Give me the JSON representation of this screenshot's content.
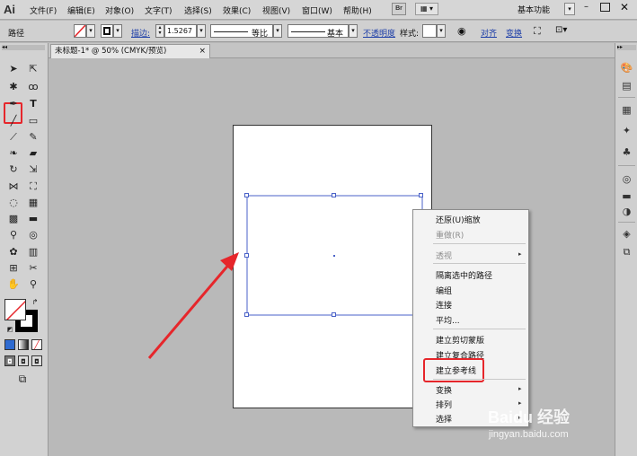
{
  "menubar": {
    "logo": "Ai",
    "items": [
      "文件(F)",
      "编辑(E)",
      "对象(O)",
      "文字(T)",
      "选择(S)",
      "效果(C)",
      "视图(V)",
      "窗口(W)",
      "帮助(H)"
    ],
    "bridge_label": "Br",
    "workspace_label": "基本功能",
    "minimize_glyph": "–",
    "close_glyph": "✕"
  },
  "controlbar": {
    "path_label": "路径",
    "stroke_label": "描边:",
    "stroke_weight": "1.5267",
    "stroke_profile": "等比",
    "brush_label": "基本",
    "opacity_label": "不透明度",
    "style_label": "样式:",
    "align_label": "对齐",
    "transform_label": "变换"
  },
  "document": {
    "tab_title": "未标题-1* @ 50% (CMYK/预览)",
    "tab_close": "×"
  },
  "context_menu": {
    "items": [
      {
        "label": "还原(U)缩放",
        "disabled": false
      },
      {
        "label": "重做(R)",
        "disabled": true
      },
      {
        "label": "透视",
        "disabled": true,
        "submenu": true
      },
      {
        "label": "隔离选中的路径",
        "disabled": false
      },
      {
        "label": "编组",
        "disabled": false
      },
      {
        "label": "连接",
        "disabled": false
      },
      {
        "label": "平均...",
        "disabled": false
      },
      {
        "label": "建立剪切蒙版",
        "disabled": false
      },
      {
        "label": "建立复合路径",
        "disabled": false
      },
      {
        "label": "建立参考线",
        "disabled": false
      },
      {
        "label": "变换",
        "disabled": false,
        "submenu": true
      },
      {
        "label": "排列",
        "disabled": false,
        "submenu": true
      },
      {
        "label": "选择",
        "disabled": false,
        "submenu": true
      }
    ],
    "highlighted_item": "建立参考线"
  },
  "watermark": {
    "brand": "Baidu 经验",
    "url": "jingyan.baidu.com"
  },
  "colors": {
    "highlight_red": "#e6262b",
    "selection_blue": "#4a62c8",
    "link_blue": "#1e3fa8"
  }
}
